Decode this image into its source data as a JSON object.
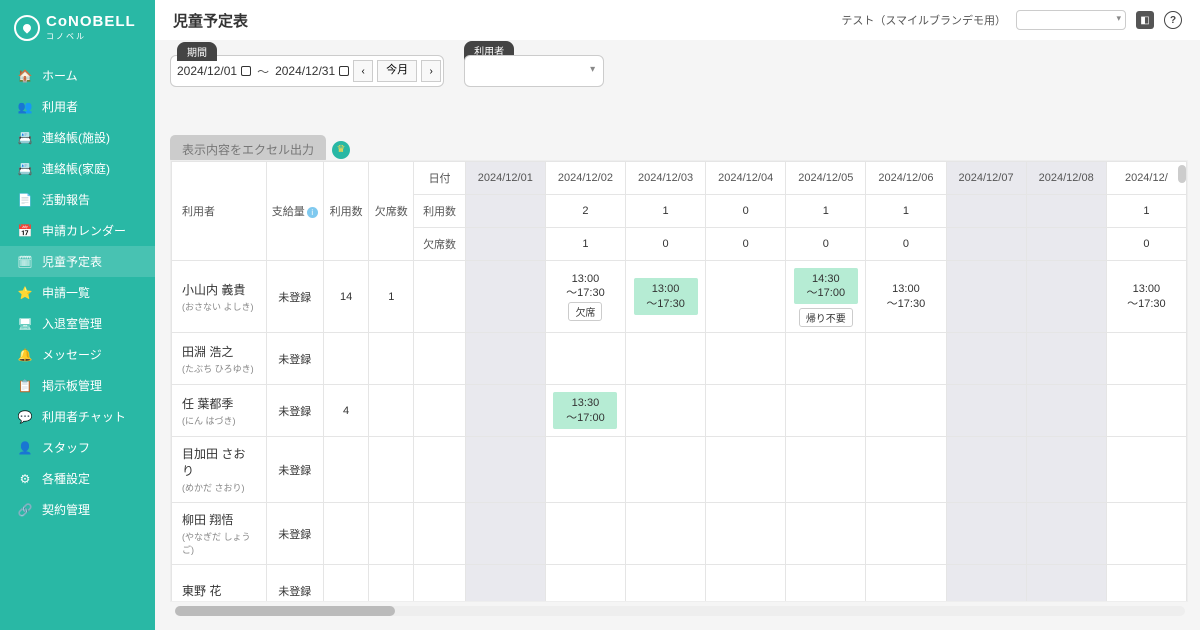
{
  "logo": {
    "main": "CoNOBELL",
    "sub": "コノベル"
  },
  "nav": [
    {
      "icon": "🏠",
      "label": "ホーム"
    },
    {
      "icon": "👥",
      "label": "利用者"
    },
    {
      "icon": "📇",
      "label": "連絡帳(施設)"
    },
    {
      "icon": "📇",
      "label": "連絡帳(家庭)"
    },
    {
      "icon": "📄",
      "label": "活動報告"
    },
    {
      "icon": "📅",
      "label": "申請カレンダー"
    },
    {
      "icon": "🗓",
      "label": "児童予定表"
    },
    {
      "icon": "⭐",
      "label": "申請一覧"
    },
    {
      "icon": "🖥",
      "label": "入退室管理"
    },
    {
      "icon": "🔔",
      "label": "メッセージ"
    },
    {
      "icon": "📋",
      "label": "掲示板管理"
    },
    {
      "icon": "💬",
      "label": "利用者チャット"
    },
    {
      "icon": "👤",
      "label": "スタッフ"
    },
    {
      "icon": "⚙",
      "label": "各種設定"
    },
    {
      "icon": "🔗",
      "label": "契約管理"
    }
  ],
  "header": {
    "title": "児童予定表",
    "org": "テスト（スマイルブランデモ用）"
  },
  "period": {
    "label": "期間",
    "from": "2024/12/01",
    "to": "2024/12/31",
    "this_month": "今月"
  },
  "userFilter": {
    "label": "利用者"
  },
  "export": {
    "label": "表示内容をエクセル出力"
  },
  "colHeads": {
    "date": "日付",
    "user": "利用者",
    "supply": "支給量",
    "use": "利用数",
    "abs": "欠席数",
    "metric_use": "利用数",
    "metric_abs": "欠席数"
  },
  "dates": [
    "2024/12/01",
    "2024/12/02",
    "2024/12/03",
    "2024/12/04",
    "2024/12/05",
    "2024/12/06",
    "2024/12/07",
    "2024/12/08",
    "2024/12/"
  ],
  "weekend": [
    0,
    6,
    7
  ],
  "metrics": {
    "use": [
      "",
      "2",
      "1",
      "0",
      "1",
      "1",
      "",
      "",
      "1"
    ],
    "abs": [
      "",
      "1",
      "0",
      "0",
      "0",
      "0",
      "",
      "",
      "0"
    ]
  },
  "users": [
    {
      "name": "小山内 義貴",
      "kana": "(おさない よしき)",
      "supply": "未登録",
      "use": "14",
      "abs": "1",
      "cells": [
        "",
        {
          "time": "13:00\n〜17:30",
          "tag": "欠席",
          "plain": true
        },
        {
          "time": "13:00\n〜17:30",
          "green": true
        },
        "",
        {
          "time": "14:30\n〜17:00",
          "green": true,
          "tag": "帰り不要"
        },
        {
          "time": "13:00\n〜17:30",
          "plain": true
        },
        "",
        "",
        {
          "time": "13:00\n〜17:30",
          "plain": true
        }
      ]
    },
    {
      "name": "田淵 浩之",
      "kana": "(たぶち ひろゆき)",
      "supply": "未登録",
      "use": "",
      "abs": "",
      "cells": [
        "",
        "",
        "",
        "",
        "",
        "",
        "",
        "",
        ""
      ]
    },
    {
      "name": "任 葉都季",
      "kana": "(にん はづき)",
      "supply": "未登録",
      "use": "4",
      "abs": "",
      "cells": [
        "",
        {
          "time": "13:30\n〜17:00",
          "green": true
        },
        "",
        "",
        "",
        "",
        "",
        "",
        ""
      ]
    },
    {
      "name": "目加田 さおり",
      "kana": "(めかだ さおり)",
      "supply": "未登録",
      "use": "",
      "abs": "",
      "cells": [
        "",
        "",
        "",
        "",
        "",
        "",
        "",
        "",
        ""
      ]
    },
    {
      "name": "柳田 翔悟",
      "kana": "(やなぎだ しょうご)",
      "supply": "未登録",
      "use": "",
      "abs": "",
      "cells": [
        "",
        "",
        "",
        "",
        "",
        "",
        "",
        "",
        ""
      ]
    },
    {
      "name": "東野 花",
      "kana": "",
      "supply": "未登録",
      "use": "",
      "abs": "",
      "cells": [
        "",
        "",
        "",
        "",
        "",
        "",
        "",
        "",
        ""
      ]
    }
  ]
}
